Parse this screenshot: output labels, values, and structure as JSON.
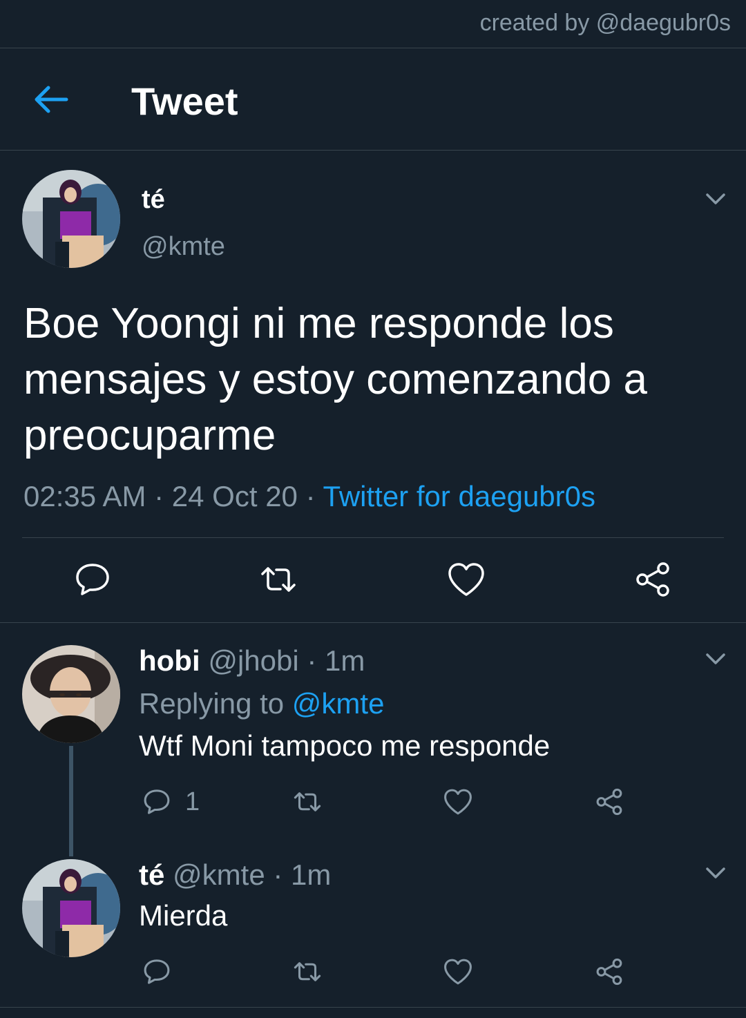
{
  "watermark": "created by @daegubr0s",
  "header": {
    "title": "Tweet",
    "back_icon": "arrow-left-icon"
  },
  "main_tweet": {
    "name": "té",
    "handle": "@kmte",
    "text": "Boe Yoongi ni me responde los mensajes y estoy comenzando a preocuparme",
    "time": "02:35 AM",
    "date": "24 Oct 20",
    "source": "Twitter for daegubr0s",
    "actions": [
      "reply-icon",
      "retweet-icon",
      "like-icon",
      "share-icon"
    ]
  },
  "replies": [
    {
      "name": "hobi",
      "handle": "@jhobi",
      "age": "1m",
      "replying_prefix": "Replying to",
      "replying_to": "@kmte",
      "text": "Wtf Moni tampoco me responde",
      "reply_count": "1"
    },
    {
      "name": "té",
      "handle": "@kmte",
      "age": "1m",
      "text": "Mierda"
    }
  ],
  "colors": {
    "background": "#15202b",
    "accent": "#1da1f2",
    "secondary_text": "#8899a6",
    "divider": "#38444d"
  }
}
